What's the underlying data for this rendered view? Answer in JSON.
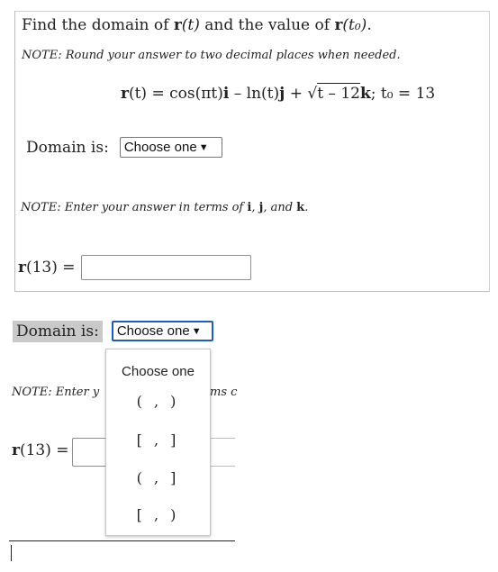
{
  "question": {
    "text_prefix": "Find the domain of ",
    "r_label": "r",
    "t_var": "(t)",
    "text_mid": " and the value of ",
    "r_label2": "r",
    "t0_var": "(t₀)",
    "text_end": "."
  },
  "note1": "NOTE: Round your answer to two decimal places when needed.",
  "equation": {
    "lhs_r": "r",
    "lhs_arg": "(t) = cos(πt)",
    "i": "i",
    "minus_ln": " – ln(t)",
    "j": "j",
    "plus": " + √",
    "sqrt_content": "t – 12",
    "k": "k",
    "tail": "; t₀ = 13"
  },
  "domain1": {
    "label": "Domain is:",
    "select_value": "Choose one"
  },
  "note2": {
    "prefix": "NOTE: Enter your answer in terms of ",
    "i": "i",
    "sep1": ", ",
    "j": "j",
    "sep2": ", and ",
    "k": "k",
    "end": "."
  },
  "r13": {
    "r": "r",
    "arg": "(13) ="
  },
  "domain2": {
    "label": "Domain is:",
    "select_value": "Choose one",
    "options": [
      "Choose one",
      "( , )",
      "[ , ]",
      "( , ]",
      "[ , )"
    ]
  },
  "note3_visible": "NOTE: Enter y",
  "note3_right": "ms c",
  "r13_lower": {
    "r": "r",
    "arg": "(13) ="
  },
  "arrow_glyph": "▼"
}
